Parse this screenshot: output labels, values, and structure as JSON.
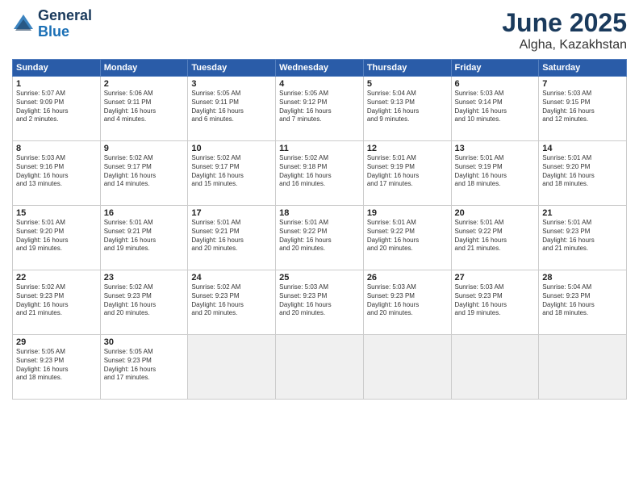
{
  "header": {
    "logo_line1": "General",
    "logo_line2": "Blue",
    "month": "June 2025",
    "location": "Algha, Kazakhstan"
  },
  "weekdays": [
    "Sunday",
    "Monday",
    "Tuesday",
    "Wednesday",
    "Thursday",
    "Friday",
    "Saturday"
  ],
  "weeks": [
    [
      {
        "day": "1",
        "info": "Sunrise: 5:07 AM\nSunset: 9:09 PM\nDaylight: 16 hours\nand 2 minutes."
      },
      {
        "day": "2",
        "info": "Sunrise: 5:06 AM\nSunset: 9:11 PM\nDaylight: 16 hours\nand 4 minutes."
      },
      {
        "day": "3",
        "info": "Sunrise: 5:05 AM\nSunset: 9:11 PM\nDaylight: 16 hours\nand 6 minutes."
      },
      {
        "day": "4",
        "info": "Sunrise: 5:05 AM\nSunset: 9:12 PM\nDaylight: 16 hours\nand 7 minutes."
      },
      {
        "day": "5",
        "info": "Sunrise: 5:04 AM\nSunset: 9:13 PM\nDaylight: 16 hours\nand 9 minutes."
      },
      {
        "day": "6",
        "info": "Sunrise: 5:03 AM\nSunset: 9:14 PM\nDaylight: 16 hours\nand 10 minutes."
      },
      {
        "day": "7",
        "info": "Sunrise: 5:03 AM\nSunset: 9:15 PM\nDaylight: 16 hours\nand 12 minutes."
      }
    ],
    [
      {
        "day": "8",
        "info": "Sunrise: 5:03 AM\nSunset: 9:16 PM\nDaylight: 16 hours\nand 13 minutes."
      },
      {
        "day": "9",
        "info": "Sunrise: 5:02 AM\nSunset: 9:17 PM\nDaylight: 16 hours\nand 14 minutes."
      },
      {
        "day": "10",
        "info": "Sunrise: 5:02 AM\nSunset: 9:17 PM\nDaylight: 16 hours\nand 15 minutes."
      },
      {
        "day": "11",
        "info": "Sunrise: 5:02 AM\nSunset: 9:18 PM\nDaylight: 16 hours\nand 16 minutes."
      },
      {
        "day": "12",
        "info": "Sunrise: 5:01 AM\nSunset: 9:19 PM\nDaylight: 16 hours\nand 17 minutes."
      },
      {
        "day": "13",
        "info": "Sunrise: 5:01 AM\nSunset: 9:19 PM\nDaylight: 16 hours\nand 18 minutes."
      },
      {
        "day": "14",
        "info": "Sunrise: 5:01 AM\nSunset: 9:20 PM\nDaylight: 16 hours\nand 18 minutes."
      }
    ],
    [
      {
        "day": "15",
        "info": "Sunrise: 5:01 AM\nSunset: 9:20 PM\nDaylight: 16 hours\nand 19 minutes."
      },
      {
        "day": "16",
        "info": "Sunrise: 5:01 AM\nSunset: 9:21 PM\nDaylight: 16 hours\nand 19 minutes."
      },
      {
        "day": "17",
        "info": "Sunrise: 5:01 AM\nSunset: 9:21 PM\nDaylight: 16 hours\nand 20 minutes."
      },
      {
        "day": "18",
        "info": "Sunrise: 5:01 AM\nSunset: 9:22 PM\nDaylight: 16 hours\nand 20 minutes."
      },
      {
        "day": "19",
        "info": "Sunrise: 5:01 AM\nSunset: 9:22 PM\nDaylight: 16 hours\nand 20 minutes."
      },
      {
        "day": "20",
        "info": "Sunrise: 5:01 AM\nSunset: 9:22 PM\nDaylight: 16 hours\nand 21 minutes."
      },
      {
        "day": "21",
        "info": "Sunrise: 5:01 AM\nSunset: 9:23 PM\nDaylight: 16 hours\nand 21 minutes."
      }
    ],
    [
      {
        "day": "22",
        "info": "Sunrise: 5:02 AM\nSunset: 9:23 PM\nDaylight: 16 hours\nand 21 minutes."
      },
      {
        "day": "23",
        "info": "Sunrise: 5:02 AM\nSunset: 9:23 PM\nDaylight: 16 hours\nand 20 minutes."
      },
      {
        "day": "24",
        "info": "Sunrise: 5:02 AM\nSunset: 9:23 PM\nDaylight: 16 hours\nand 20 minutes."
      },
      {
        "day": "25",
        "info": "Sunrise: 5:03 AM\nSunset: 9:23 PM\nDaylight: 16 hours\nand 20 minutes."
      },
      {
        "day": "26",
        "info": "Sunrise: 5:03 AM\nSunset: 9:23 PM\nDaylight: 16 hours\nand 20 minutes."
      },
      {
        "day": "27",
        "info": "Sunrise: 5:03 AM\nSunset: 9:23 PM\nDaylight: 16 hours\nand 19 minutes."
      },
      {
        "day": "28",
        "info": "Sunrise: 5:04 AM\nSunset: 9:23 PM\nDaylight: 16 hours\nand 18 minutes."
      }
    ],
    [
      {
        "day": "29",
        "info": "Sunrise: 5:05 AM\nSunset: 9:23 PM\nDaylight: 16 hours\nand 18 minutes."
      },
      {
        "day": "30",
        "info": "Sunrise: 5:05 AM\nSunset: 9:23 PM\nDaylight: 16 hours\nand 17 minutes."
      },
      {
        "day": "",
        "info": ""
      },
      {
        "day": "",
        "info": ""
      },
      {
        "day": "",
        "info": ""
      },
      {
        "day": "",
        "info": ""
      },
      {
        "day": "",
        "info": ""
      }
    ]
  ]
}
